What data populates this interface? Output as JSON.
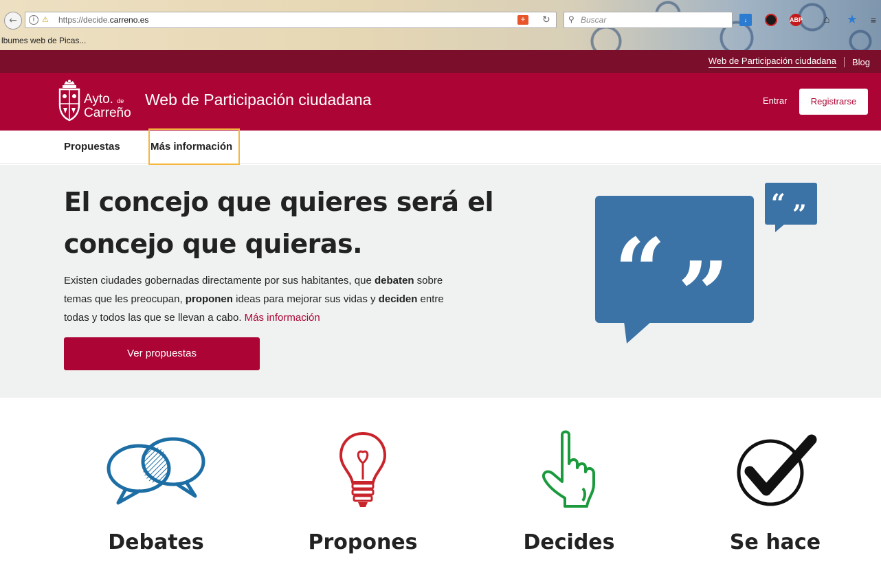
{
  "browser": {
    "url_prefix": "https://decide.",
    "url_domain": "carreno.es",
    "search_placeholder": "Buscar",
    "bookmark": "lbumes web de Picas..."
  },
  "topbar": {
    "link_participation": "Web de Participación ciudadana",
    "link_blog": "Blog"
  },
  "header": {
    "logo_line1": "Ayto.",
    "logo_de": "de",
    "logo_line2": "Carreño",
    "site_title": "Web de Participación ciudadana",
    "login": "Entrar",
    "register": "Registrarse"
  },
  "nav": {
    "tabs": [
      {
        "label": "Propuestas"
      },
      {
        "label": "Más información"
      }
    ]
  },
  "hero": {
    "title": "El concejo que quieres será el concejo que quieras.",
    "desc_1": "Existen ciudades gobernadas directamente por sus habitantes, que ",
    "desc_b1": "debaten",
    "desc_2": " sobre temas que les preocupan, ",
    "desc_b2": "proponen",
    "desc_3": " ideas para mejorar sus vidas y ",
    "desc_b3": "deciden",
    "desc_4": " entre todas y todos las que se llevan a cabo.  ",
    "more_link": "Más información",
    "cta": "Ver propuestas"
  },
  "steps": [
    {
      "label": "Debates",
      "icon": "debates-icon",
      "color": "#1c6ea4"
    },
    {
      "label": "Propones",
      "icon": "lightbulb-icon",
      "color": "#c9242c"
    },
    {
      "label": "Decides",
      "icon": "hand-pointer-icon",
      "color": "#1a9a3c"
    },
    {
      "label": "Se hace",
      "icon": "checkmark-icon",
      "color": "#111111"
    }
  ],
  "colors": {
    "brand": "#ac0535",
    "topbar": "#7b0e2a",
    "hero_bg": "#f0f1f1",
    "quote_blue": "#3c73a6"
  }
}
